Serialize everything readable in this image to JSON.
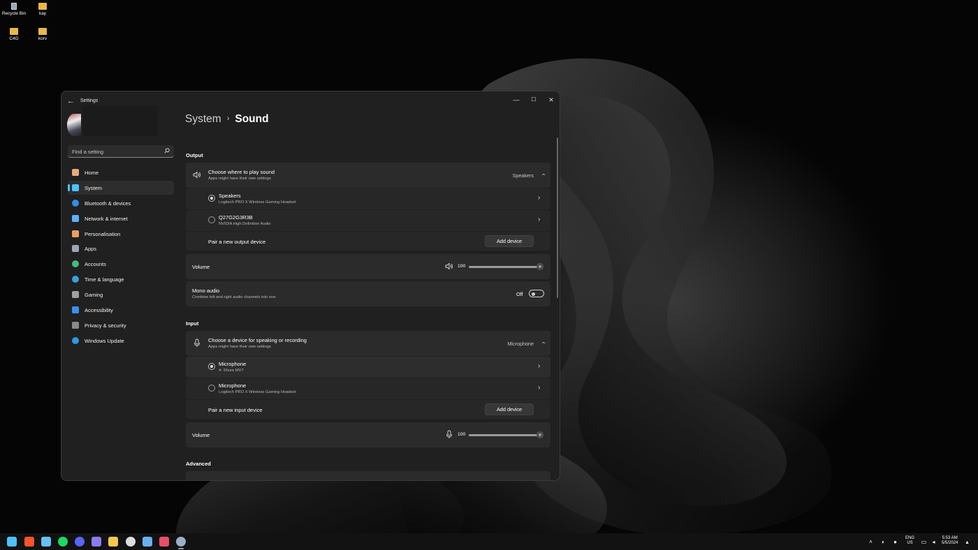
{
  "desktop": {
    "icons": [
      {
        "label": "Recycle Bin",
        "icon": "recycle-bin-icon"
      },
      {
        "label": "kay",
        "icon": "folder-icon"
      },
      {
        "label": "C4G",
        "icon": "folder-icon"
      },
      {
        "label": "korv",
        "icon": "folder-icon"
      }
    ]
  },
  "window": {
    "title": "Settings",
    "controls": {
      "minimize": "—",
      "maximize": "☐",
      "close": "✕"
    }
  },
  "sidebar": {
    "search_placeholder": "Find a setting",
    "items": [
      {
        "label": "Home",
        "icon": "home-icon",
        "color": "#e8a87c"
      },
      {
        "label": "System",
        "icon": "system-icon",
        "color": "#4cc2ff",
        "active": true
      },
      {
        "label": "Bluetooth & devices",
        "icon": "bluetooth-icon",
        "color": "#2f8fe8"
      },
      {
        "label": "Network & internet",
        "icon": "wifi-icon",
        "color": "#5ab0ff"
      },
      {
        "label": "Personalisation",
        "icon": "brush-icon",
        "color": "#e8a060"
      },
      {
        "label": "Apps",
        "icon": "apps-icon",
        "color": "#9aa6b5"
      },
      {
        "label": "Accounts",
        "icon": "accounts-icon",
        "color": "#3fbf7f"
      },
      {
        "label": "Time & language",
        "icon": "globe-icon",
        "color": "#3aa0e0"
      },
      {
        "label": "Gaming",
        "icon": "gamepad-icon",
        "color": "#a0a0a0"
      },
      {
        "label": "Accessibility",
        "icon": "accessibility-icon",
        "color": "#3a8ff0"
      },
      {
        "label": "Privacy & security",
        "icon": "shield-icon",
        "color": "#8a8a8a"
      },
      {
        "label": "Windows Update",
        "icon": "update-icon",
        "color": "#2a9ae0"
      }
    ]
  },
  "breadcrumb": {
    "parent": "System",
    "separator": "›",
    "current": "Sound"
  },
  "output": {
    "heading": "Output",
    "chooser": {
      "title": "Choose where to play sound",
      "subtitle": "Apps might have their own settings",
      "value": "Speakers"
    },
    "devices": [
      {
        "name": "Speakers",
        "detail": "Logitech PRO X Wireless Gaming Headset",
        "selected": true
      },
      {
        "name": "Q27G2G3R3B",
        "detail": "NVIDIA High Definition Audio",
        "selected": false
      }
    ],
    "pair_label": "Pair a new output device",
    "add_button": "Add device",
    "volume_label": "Volume",
    "volume_value": "100",
    "mono": {
      "title": "Mono audio",
      "subtitle": "Combine left and right audio channels into one",
      "state": "Off"
    }
  },
  "input": {
    "heading": "Input",
    "chooser": {
      "title": "Choose a device for speaking or recording",
      "subtitle": "Apps might have their own settings",
      "value": "Microphone"
    },
    "devices": [
      {
        "name": "Microphone",
        "detail": "4- Shure MV7",
        "selected": true
      },
      {
        "name": "Microphone",
        "detail": "Logitech PRO X Wireless Gaming Headset",
        "selected": false
      }
    ],
    "pair_label": "Pair a new input device",
    "add_button": "Add device",
    "volume_label": "Volume",
    "volume_value": "100"
  },
  "advanced": {
    "heading": "Advanced"
  },
  "taskbar": {
    "apps": [
      {
        "icon": "windows-start-icon",
        "color": "#4cc2ff"
      },
      {
        "icon": "brave-icon",
        "color": "#fb542b"
      },
      {
        "icon": "steam-icon",
        "color": "#66c0f4"
      },
      {
        "icon": "spotify-icon",
        "color": "#1ed760"
      },
      {
        "icon": "discord-icon",
        "color": "#5865f2"
      },
      {
        "icon": "mail-icon",
        "color": "#8a7cf0"
      },
      {
        "icon": "file-explorer-icon",
        "color": "#f2c94c"
      },
      {
        "icon": "obs-icon",
        "color": "#dddddd"
      },
      {
        "icon": "notepad-icon",
        "color": "#6ab0f0"
      },
      {
        "icon": "snipping-icon",
        "color": "#e8506a"
      },
      {
        "icon": "settings-icon",
        "color": "#9ab0c8"
      }
    ],
    "tray": {
      "language": "ENG",
      "region": "US",
      "time": "5:53 AM",
      "date": "5/5/2024"
    }
  }
}
